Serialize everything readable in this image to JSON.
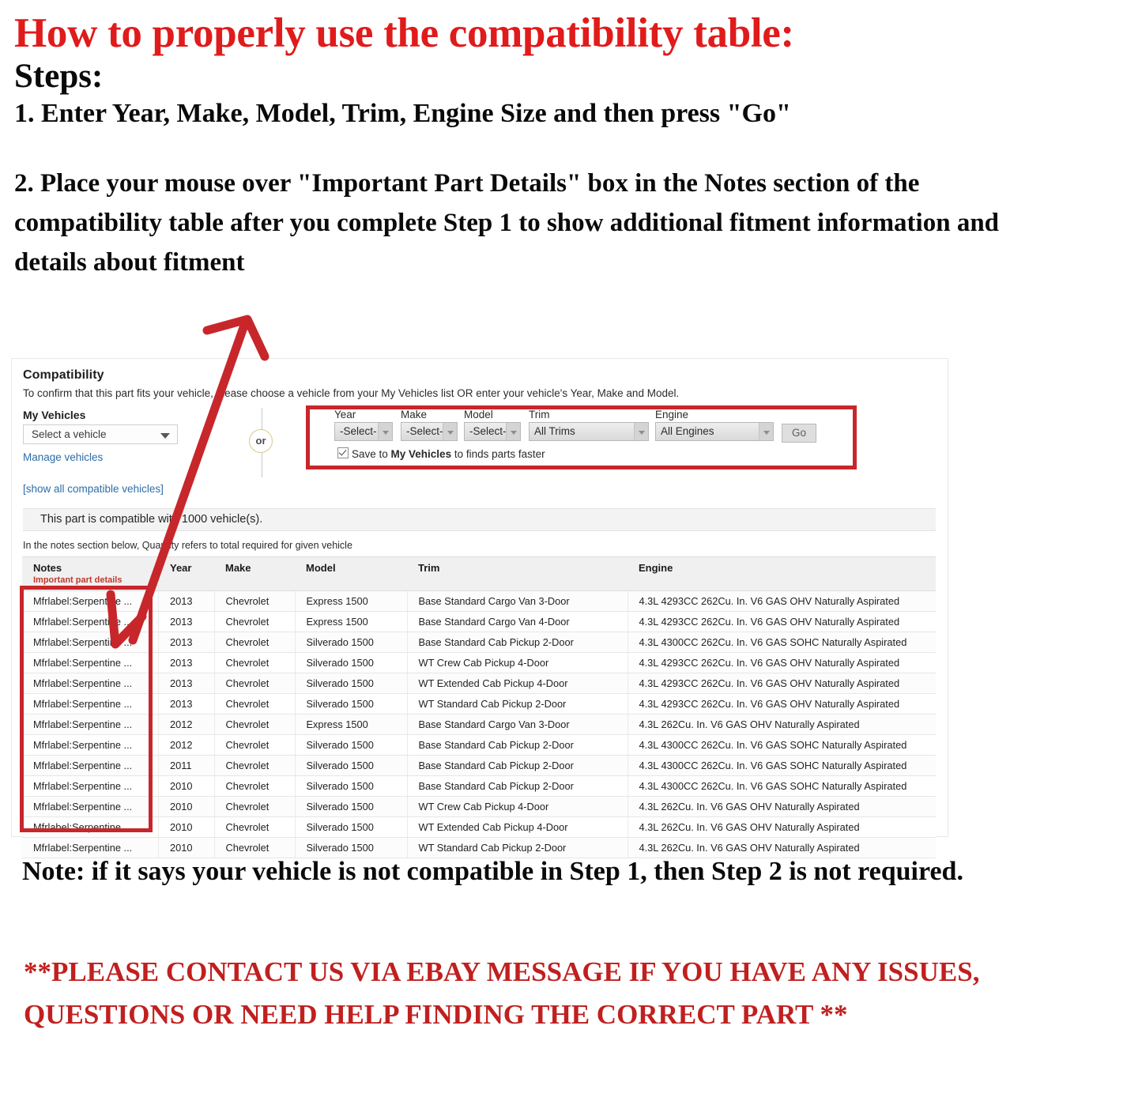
{
  "instructions": {
    "title": "How to properly use the compatibility table:",
    "steps_label": "Steps:",
    "step_one": "1. Enter Year, Make, Model, Trim, Engine Size and then press \"Go\"",
    "step_two": "2. Place your mouse over \"Important Part Details\" box in the Notes section of the compatibility table after you complete Step 1 to show additional fitment information and details about fitment",
    "note": "Note: if it says your vehicle is not compatible in Step 1, then Step 2 is not required.",
    "contact": "**PLEASE CONTACT US VIA EBAY MESSAGE IF YOU HAVE ANY ISSUES, QUESTIONS OR NEED HELP FINDING THE CORRECT PART **"
  },
  "panel": {
    "heading": "Compatibility",
    "subtitle": "To confirm that this part fits your vehicle, please choose a vehicle from your My Vehicles list OR enter your vehicle's Year, Make and Model.",
    "my_vehicles_label": "My Vehicles",
    "vehicle_select_value": "Select a vehicle",
    "manage_vehicles_link": "Manage vehicles",
    "show_all_link": "[show all compatible vehicles]",
    "or_label": "or",
    "compat_message": "This part is compatible with 1000 vehicle(s).",
    "notes_hint": "In the notes section below, Quantity refers to total required for given vehicle"
  },
  "form": {
    "fields": [
      {
        "label": "Year",
        "value": "-Select-"
      },
      {
        "label": "Make",
        "value": "-Select-"
      },
      {
        "label": "Model",
        "value": "-Select-"
      },
      {
        "label": "Trim",
        "value": "All Trims"
      },
      {
        "label": "Engine",
        "value": "All Engines"
      }
    ],
    "go_label": "Go",
    "save_prefix": "Save to ",
    "save_bold": "My Vehicles",
    "save_suffix": " to finds parts faster"
  },
  "table": {
    "headers": {
      "notes": "Notes",
      "notes_sub": "Important part details",
      "year": "Year",
      "make": "Make",
      "model": "Model",
      "trim": "Trim",
      "engine": "Engine"
    },
    "rows": [
      {
        "notes": "Mfrlabel:Serpentine ...",
        "year": "2013",
        "make": "Chevrolet",
        "model": "Express 1500",
        "trim": "Base Standard Cargo Van 3-Door",
        "engine": "4.3L 4293CC 262Cu. In. V6 GAS OHV Naturally Aspirated"
      },
      {
        "notes": "Mfrlabel:Serpentine ...",
        "year": "2013",
        "make": "Chevrolet",
        "model": "Express 1500",
        "trim": "Base Standard Cargo Van 4-Door",
        "engine": "4.3L 4293CC 262Cu. In. V6 GAS OHV Naturally Aspirated"
      },
      {
        "notes": "Mfrlabel:Serpentine ...",
        "year": "2013",
        "make": "Chevrolet",
        "model": "Silverado 1500",
        "trim": "Base Standard Cab Pickup 2-Door",
        "engine": "4.3L 4300CC 262Cu. In. V6 GAS SOHC Naturally Aspirated"
      },
      {
        "notes": "Mfrlabel:Serpentine ...",
        "year": "2013",
        "make": "Chevrolet",
        "model": "Silverado 1500",
        "trim": "WT Crew Cab Pickup 4-Door",
        "engine": "4.3L 4293CC 262Cu. In. V6 GAS OHV Naturally Aspirated"
      },
      {
        "notes": "Mfrlabel:Serpentine ...",
        "year": "2013",
        "make": "Chevrolet",
        "model": "Silverado 1500",
        "trim": "WT Extended Cab Pickup 4-Door",
        "engine": "4.3L 4293CC 262Cu. In. V6 GAS OHV Naturally Aspirated"
      },
      {
        "notes": "Mfrlabel:Serpentine ...",
        "year": "2013",
        "make": "Chevrolet",
        "model": "Silverado 1500",
        "trim": "WT Standard Cab Pickup 2-Door",
        "engine": "4.3L 4293CC 262Cu. In. V6 GAS OHV Naturally Aspirated"
      },
      {
        "notes": "Mfrlabel:Serpentine ...",
        "year": "2012",
        "make": "Chevrolet",
        "model": "Express 1500",
        "trim": "Base Standard Cargo Van 3-Door",
        "engine": "4.3L 262Cu. In. V6 GAS OHV Naturally Aspirated"
      },
      {
        "notes": "Mfrlabel:Serpentine ...",
        "year": "2012",
        "make": "Chevrolet",
        "model": "Silverado 1500",
        "trim": "Base Standard Cab Pickup 2-Door",
        "engine": "4.3L 4300CC 262Cu. In. V6 GAS SOHC Naturally Aspirated"
      },
      {
        "notes": "Mfrlabel:Serpentine ...",
        "year": "2011",
        "make": "Chevrolet",
        "model": "Silverado 1500",
        "trim": "Base Standard Cab Pickup 2-Door",
        "engine": "4.3L 4300CC 262Cu. In. V6 GAS SOHC Naturally Aspirated"
      },
      {
        "notes": "Mfrlabel:Serpentine ...",
        "year": "2010",
        "make": "Chevrolet",
        "model": "Silverado 1500",
        "trim": "Base Standard Cab Pickup 2-Door",
        "engine": "4.3L 4300CC 262Cu. In. V6 GAS SOHC Naturally Aspirated"
      },
      {
        "notes": "Mfrlabel:Serpentine ...",
        "year": "2010",
        "make": "Chevrolet",
        "model": "Silverado 1500",
        "trim": "WT Crew Cab Pickup 4-Door",
        "engine": "4.3L 262Cu. In. V6 GAS OHV Naturally Aspirated"
      },
      {
        "notes": "Mfrlabel:Serpentine ...",
        "year": "2010",
        "make": "Chevrolet",
        "model": "Silverado 1500",
        "trim": "WT Extended Cab Pickup 4-Door",
        "engine": "4.3L 262Cu. In. V6 GAS OHV Naturally Aspirated"
      },
      {
        "notes": "Mfrlabel:Serpentine ...",
        "year": "2010",
        "make": "Chevrolet",
        "model": "Silverado 1500",
        "trim": "WT Standard Cab Pickup 2-Door",
        "engine": "4.3L 262Cu. In. V6 GAS OHV Naturally Aspirated"
      }
    ]
  },
  "colors": {
    "title_red": "#e01b1b",
    "annotation_red": "#c7272b",
    "link_blue": "#2d6da8",
    "notes_sub_red": "#c0392b"
  }
}
